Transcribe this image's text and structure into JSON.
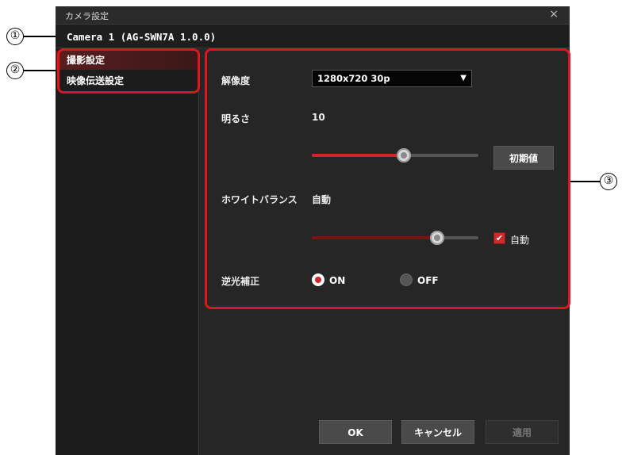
{
  "window": {
    "title": "カメラ設定",
    "close_glyph": "×",
    "camera_name": "Camera 1 (AG-SWN7A 1.0.0)"
  },
  "sidebar": {
    "items": [
      {
        "label": "撮影設定",
        "active": true
      },
      {
        "label": "映像伝送設定",
        "active": false
      }
    ]
  },
  "settings": {
    "resolution": {
      "label": "解像度",
      "value": "1280x720 30p",
      "arrow": "▼"
    },
    "brightness": {
      "label": "明るさ",
      "value": "10",
      "slider_fraction": 0.55,
      "reset_label": "初期値"
    },
    "white_balance": {
      "label": "ホワイトバランス",
      "value": "自動",
      "slider_fraction": 0.75,
      "auto_label": "自動",
      "auto_checked": true
    },
    "backlight": {
      "label": "逆光補正",
      "on_label": "ON",
      "off_label": "OFF",
      "selected": "ON"
    }
  },
  "footer": {
    "ok_label": "OK",
    "cancel_label": "キャンセル",
    "apply_label": "適用",
    "apply_enabled": false
  },
  "callouts": [
    "①",
    "②",
    "③"
  ],
  "colors": {
    "accent_red": "#e0151c",
    "slider_red": "#d0252a",
    "slider_dark_red": "#7a1414",
    "window_bg": "#1e1e1e"
  }
}
